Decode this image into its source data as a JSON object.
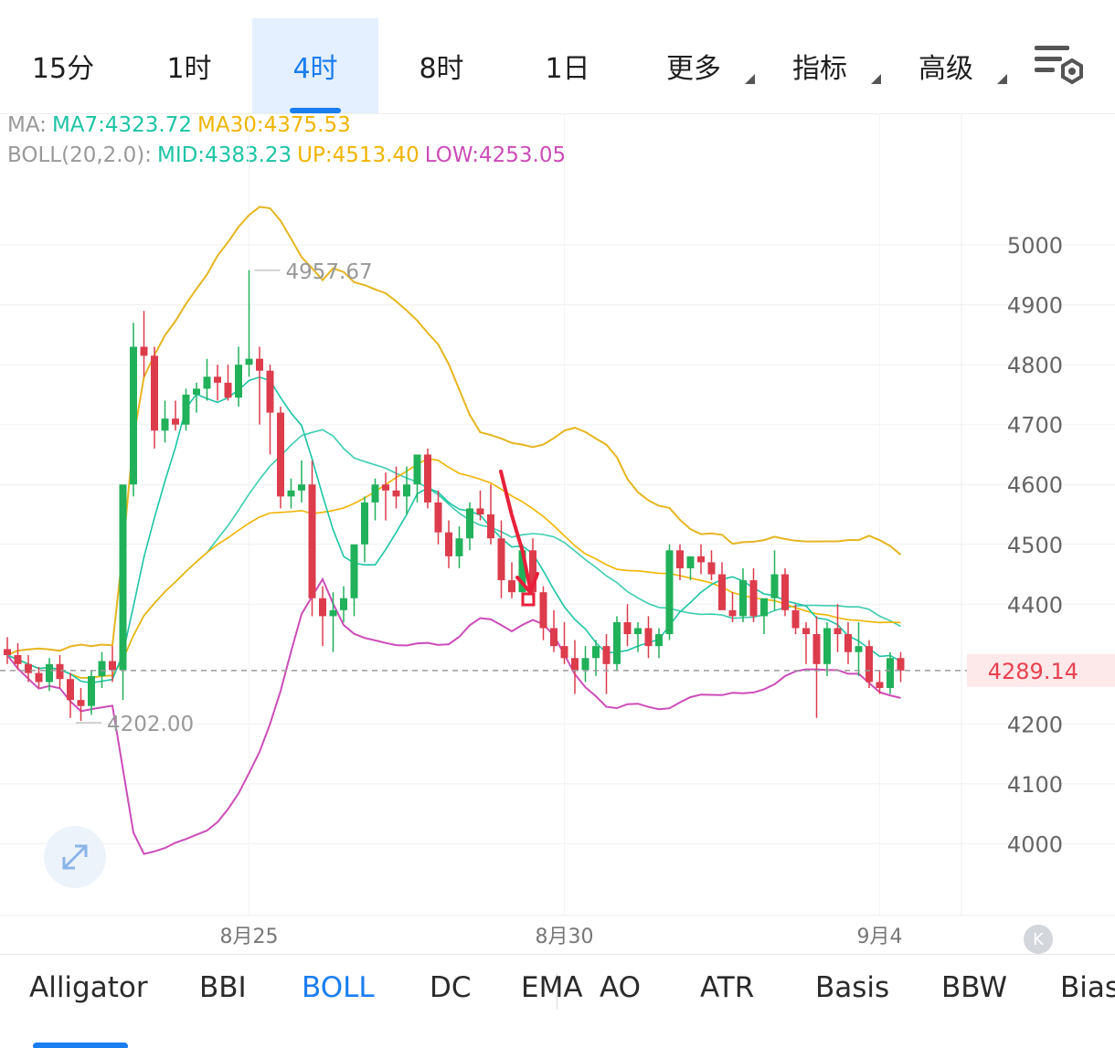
{
  "tabs": [
    {
      "label": "15分",
      "active": false,
      "dropdown": false
    },
    {
      "label": "1时",
      "active": false,
      "dropdown": false
    },
    {
      "label": "4时",
      "active": true,
      "dropdown": false
    },
    {
      "label": "8时",
      "active": false,
      "dropdown": false
    },
    {
      "label": "1日",
      "active": false,
      "dropdown": false
    },
    {
      "label": "更多",
      "active": false,
      "dropdown": true
    },
    {
      "label": "指标",
      "active": false,
      "dropdown": true
    },
    {
      "label": "高级",
      "active": false,
      "dropdown": true
    }
  ],
  "settings_icon": "chart-settings-icon",
  "legend": {
    "ma": {
      "prefix": "MA:",
      "ma7": "MA7:4323.72",
      "ma30": "MA30:4375.53"
    },
    "boll": {
      "prefix": "BOLL(20,2.0):",
      "mid": "MID:4383.23",
      "up": "UP:4513.40",
      "low": "LOW:4253.05"
    }
  },
  "colors": {
    "up": "#20b15a",
    "down": "#dc3c4c",
    "ma7": "#1cc4a5",
    "ma30": "#f0b400",
    "boll_up": "#e6b520",
    "boll_mid": "#3ccdb0",
    "boll_low": "#cc4cb8",
    "accent": "#1a7df0",
    "price_tag": "#e8414f"
  },
  "chart_data": {
    "type": "candlestick",
    "title": "",
    "y_axis": {
      "ticks": [
        5000,
        4900,
        4800,
        4700,
        4600,
        4500,
        4400,
        4200,
        4100,
        4000
      ],
      "range": [
        3880,
        5220
      ]
    },
    "x_axis": {
      "labels": [
        {
          "text": "8月25",
          "index": 23
        },
        {
          "text": "8月30",
          "index": 53
        },
        {
          "text": "9月4",
          "index": 83
        }
      ]
    },
    "last_price": "4289.14",
    "high_annotation": {
      "text": "4957.67",
      "index": 23,
      "value": 4957.67
    },
    "low_annotation": {
      "text": "4202.00",
      "index": 6,
      "value": 4202.0
    },
    "candles": [
      [
        4325,
        4345,
        4300,
        4315
      ],
      [
        4315,
        4335,
        4290,
        4300
      ],
      [
        4300,
        4315,
        4270,
        4285
      ],
      [
        4285,
        4295,
        4260,
        4270
      ],
      [
        4270,
        4310,
        4255,
        4300
      ],
      [
        4300,
        4315,
        4260,
        4275
      ],
      [
        4275,
        4285,
        4210,
        4240
      ],
      [
        4240,
        4260,
        4205,
        4230
      ],
      [
        4230,
        4290,
        4215,
        4280
      ],
      [
        4280,
        4320,
        4260,
        4305
      ],
      [
        4305,
        4330,
        4270,
        4290
      ],
      [
        4290,
        4440,
        4240,
        4600
      ],
      [
        4600,
        4870,
        4580,
        4830
      ],
      [
        4830,
        4890,
        4780,
        4815
      ],
      [
        4815,
        4830,
        4660,
        4690
      ],
      [
        4690,
        4740,
        4670,
        4710
      ],
      [
        4710,
        4740,
        4690,
        4700
      ],
      [
        4700,
        4760,
        4690,
        4750
      ],
      [
        4750,
        4770,
        4720,
        4760
      ],
      [
        4760,
        4810,
        4740,
        4780
      ],
      [
        4780,
        4800,
        4740,
        4770
      ],
      [
        4770,
        4800,
        4740,
        4745
      ],
      [
        4745,
        4830,
        4730,
        4800
      ],
      [
        4800,
        4958,
        4780,
        4810
      ],
      [
        4810,
        4830,
        4700,
        4790
      ],
      [
        4790,
        4800,
        4650,
        4720
      ],
      [
        4720,
        4730,
        4560,
        4580
      ],
      [
        4580,
        4610,
        4560,
        4590
      ],
      [
        4590,
        4640,
        4570,
        4600
      ],
      [
        4600,
        4640,
        4380,
        4410
      ],
      [
        4410,
        4430,
        4330,
        4380
      ],
      [
        4380,
        4420,
        4320,
        4390
      ],
      [
        4390,
        4430,
        4370,
        4410
      ],
      [
        4410,
        4460,
        4380,
        4500
      ],
      [
        4500,
        4580,
        4470,
        4570
      ],
      [
        4570,
        4610,
        4540,
        4600
      ],
      [
        4600,
        4620,
        4540,
        4590
      ],
      [
        4590,
        4630,
        4560,
        4580
      ],
      [
        4580,
        4630,
        4550,
        4600
      ],
      [
        4600,
        4640,
        4570,
        4650
      ],
      [
        4650,
        4660,
        4560,
        4570
      ],
      [
        4570,
        4590,
        4500,
        4520
      ],
      [
        4520,
        4540,
        4460,
        4480
      ],
      [
        4480,
        4530,
        4460,
        4510
      ],
      [
        4510,
        4570,
        4490,
        4560
      ],
      [
        4560,
        4590,
        4540,
        4550
      ],
      [
        4550,
        4600,
        4500,
        4510
      ],
      [
        4510,
        4540,
        4410,
        4440
      ],
      [
        4440,
        4470,
        4410,
        4420
      ],
      [
        4420,
        4500,
        4410,
        4490
      ],
      [
        4490,
        4510,
        4410,
        4420
      ],
      [
        4420,
        4430,
        4340,
        4360
      ],
      [
        4360,
        4390,
        4320,
        4330
      ],
      [
        4330,
        4370,
        4300,
        4310
      ],
      [
        4310,
        4340,
        4250,
        4290
      ],
      [
        4290,
        4330,
        4270,
        4310
      ],
      [
        4310,
        4340,
        4280,
        4330
      ],
      [
        4330,
        4350,
        4250,
        4300
      ],
      [
        4300,
        4380,
        4290,
        4370
      ],
      [
        4370,
        4400,
        4330,
        4350
      ],
      [
        4350,
        4370,
        4320,
        4360
      ],
      [
        4360,
        4380,
        4310,
        4330
      ],
      [
        4330,
        4360,
        4310,
        4350
      ],
      [
        4350,
        4500,
        4340,
        4490
      ],
      [
        4490,
        4500,
        4440,
        4460
      ],
      [
        4460,
        4480,
        4440,
        4480
      ],
      [
        4480,
        4500,
        4450,
        4470
      ],
      [
        4470,
        4490,
        4440,
        4450
      ],
      [
        4450,
        4470,
        4400,
        4390
      ],
      [
        4390,
        4420,
        4370,
        4380
      ],
      [
        4380,
        4460,
        4370,
        4440
      ],
      [
        4440,
        4460,
        4370,
        4380
      ],
      [
        4380,
        4400,
        4350,
        4410
      ],
      [
        4410,
        4490,
        4390,
        4450
      ],
      [
        4450,
        4460,
        4380,
        4390
      ],
      [
        4390,
        4400,
        4350,
        4360
      ],
      [
        4360,
        4370,
        4300,
        4350
      ],
      [
        4350,
        4380,
        4210,
        4300
      ],
      [
        4300,
        4370,
        4280,
        4360
      ],
      [
        4360,
        4400,
        4320,
        4350
      ],
      [
        4350,
        4370,
        4300,
        4320
      ],
      [
        4320,
        4370,
        4280,
        4330
      ],
      [
        4330,
        4340,
        4260,
        4270
      ],
      [
        4270,
        4290,
        4250,
        4260
      ],
      [
        4260,
        4320,
        4250,
        4310
      ],
      [
        4310,
        4320,
        4270,
        4289.14
      ]
    ]
  },
  "indicators": [
    {
      "label": "Alligator",
      "active": false
    },
    {
      "label": "BBI",
      "active": false
    },
    {
      "label": "BOLL",
      "active": true
    },
    {
      "label": "DC",
      "active": false
    },
    {
      "label": "EMA",
      "active": false
    },
    {
      "label": "AO",
      "active": false
    },
    {
      "label": "ATR",
      "active": false
    },
    {
      "label": "Basis",
      "active": false
    },
    {
      "label": "BBW",
      "active": false
    },
    {
      "label": "Bias",
      "active": false
    }
  ],
  "expand_icon": "expand-arrows-icon",
  "collapse_icon": "collapse-left-icon"
}
